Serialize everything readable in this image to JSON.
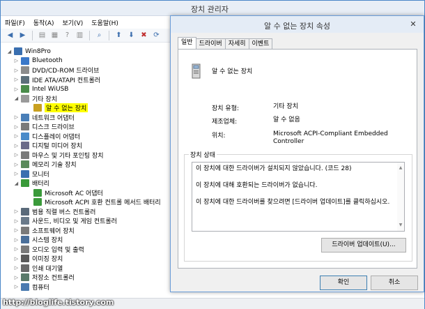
{
  "window": {
    "title": "장치 관리자"
  },
  "menu": [
    "파일(F)",
    "동작(A)",
    "보기(V)",
    "도움말(H)"
  ],
  "tree": {
    "root": "Win8Pro",
    "items": [
      {
        "label": "Bluetooth",
        "level": 1,
        "exp": "▷",
        "icon": "#3a78c9"
      },
      {
        "label": "DVD/CD-ROM 드라이브",
        "level": 1,
        "exp": "▷",
        "icon": "#8c8c8c"
      },
      {
        "label": "IDE ATA/ATAPI 컨트롤러",
        "level": 1,
        "exp": "▷",
        "icon": "#5c6f7a"
      },
      {
        "label": "Intel WiUSB",
        "level": 1,
        "exp": "▷",
        "icon": "#4a8c4a"
      },
      {
        "label": "기타 장치",
        "level": 1,
        "exp": "◢",
        "icon": "#9a9a9a"
      },
      {
        "label": "알 수 없는 장치",
        "level": 2,
        "exp": "",
        "icon": "#c9a020",
        "highlight": true
      },
      {
        "label": "네트워크 어댑터",
        "level": 1,
        "exp": "▷",
        "icon": "#4a7fb8"
      },
      {
        "label": "디스크 드라이브",
        "level": 1,
        "exp": "▷",
        "icon": "#7a7a7a"
      },
      {
        "label": "디스플레이 어댑터",
        "level": 1,
        "exp": "▷",
        "icon": "#4a8bc9"
      },
      {
        "label": "디지털 미디어 장치",
        "level": 1,
        "exp": "▷",
        "icon": "#6a6a8a"
      },
      {
        "label": "마우스 및 기타 포인팅 장치",
        "level": 1,
        "exp": "▷",
        "icon": "#7a7a7a"
      },
      {
        "label": "메모리 기술 장치",
        "level": 1,
        "exp": "▷",
        "icon": "#5a8a5a"
      },
      {
        "label": "모니터",
        "level": 1,
        "exp": "▷",
        "icon": "#3a6fb0"
      },
      {
        "label": "배터리",
        "level": 1,
        "exp": "◢",
        "icon": "#3a9a3a"
      },
      {
        "label": "Microsoft AC 어댑터",
        "level": 2,
        "exp": "",
        "icon": "#3a9a3a"
      },
      {
        "label": "Microsoft ACPI 호환 컨트롤 메서드 배터리",
        "level": 2,
        "exp": "",
        "icon": "#3a9a3a"
      },
      {
        "label": "범용 직렬 버스 컨트롤러",
        "level": 1,
        "exp": "▷",
        "icon": "#5a6a7a"
      },
      {
        "label": "사운드, 비디오 및 게임 컨트롤러",
        "level": 1,
        "exp": "▷",
        "icon": "#6a7a8a"
      },
      {
        "label": "소프트웨어 장치",
        "level": 1,
        "exp": "▷",
        "icon": "#7a7a7a"
      },
      {
        "label": "시스템 장치",
        "level": 1,
        "exp": "▷",
        "icon": "#4a6f9a"
      },
      {
        "label": "오디오 입력 및 출력",
        "level": 1,
        "exp": "▷",
        "icon": "#7a7a7a"
      },
      {
        "label": "이미징 장치",
        "level": 1,
        "exp": "▷",
        "icon": "#5a5a5a"
      },
      {
        "label": "인쇄 대기열",
        "level": 1,
        "exp": "▷",
        "icon": "#6a6a6a"
      },
      {
        "label": "저장소 컨트롤러",
        "level": 1,
        "exp": "▷",
        "icon": "#5a7a6a"
      },
      {
        "label": "컴퓨터",
        "level": 1,
        "exp": "▷",
        "icon": "#4a7ab0"
      }
    ]
  },
  "dialog": {
    "title": "알 수 없는 장치 속성",
    "close": "✕",
    "tabs": [
      "일반",
      "드라이버",
      "자세히",
      "이벤트"
    ],
    "device_name": "알 수 없는 장치",
    "props": {
      "type_label": "장치 유형:",
      "type_value": "기타 장치",
      "maker_label": "제조업체:",
      "maker_value": "알 수 없음",
      "location_label": "위치:",
      "location_value": "Microsoft ACPI-Compliant Embedded Controller"
    },
    "status_group": "장치 상태",
    "status_lines": [
      "이 장치에 대한 드라이버가 설치되지 않았습니다. (코드 28)",
      "이 장치에 대해 호환되는 드라이버가 없습니다.",
      "이 장치에 대한 드라이버를 찾으려면 [드라이버 업데이트]를 클릭하십시오."
    ],
    "update_button": "드라이버 업데이트(U)...",
    "ok_button": "확인",
    "cancel_button": "취소"
  },
  "watermark": "http://bloglife.tistory.com"
}
